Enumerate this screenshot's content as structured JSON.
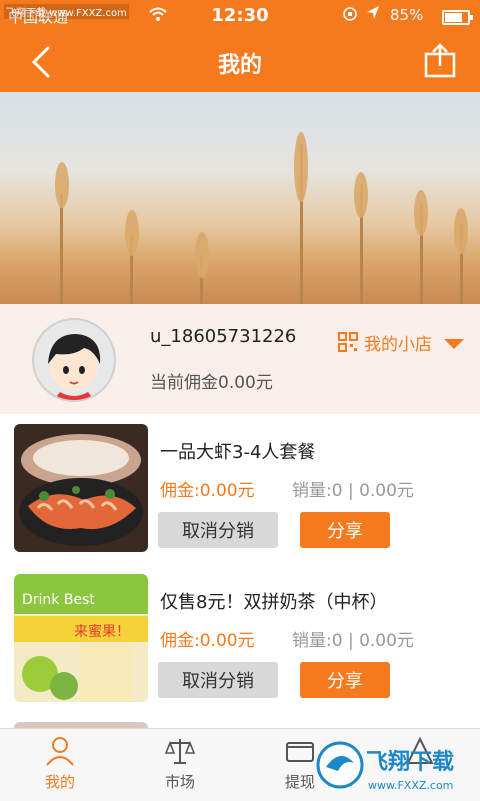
{
  "status": {
    "carrier": "中国联通",
    "time": "12:30",
    "battery": "85%",
    "battery_level": 0.85
  },
  "header": {
    "title": "我的"
  },
  "profile": {
    "username": "u_18605731226",
    "commission_total": "当前佣金0.00元",
    "myshop_label": "我的小店"
  },
  "products": [
    {
      "name": "一品大虾3-4人套餐",
      "commission": "佣金:0.00元",
      "sales": "销量:0 | 0.00元",
      "cancel_label": "取消分销",
      "share_label": "分享",
      "thumb": "shrimp-dish-image"
    },
    {
      "name": "仅售8元！双拼奶茶（中杯）",
      "commission": "佣金:0.00元",
      "sales": "销量:0 | 0.00元",
      "cancel_label": "取消分销",
      "share_label": "分享",
      "thumb": "milk-tea-image"
    }
  ],
  "tabbar": {
    "items": [
      {
        "label": "我的",
        "icon": "person-icon",
        "active": true
      },
      {
        "label": "市场",
        "icon": "scale-icon"
      },
      {
        "label": "提现",
        "icon": "wallet-icon"
      },
      {
        "label": "",
        "icon": "more-icon"
      }
    ]
  },
  "watermark": {
    "top": "飞翔下载 www.FXXZ.com",
    "logo": "飞翔下载",
    "logo_url": "www.FXXZ.com"
  },
  "colors": {
    "brand": "#f57a1d",
    "gray_button": "#d8d8d8",
    "profile_bg": "#f8eeea"
  }
}
